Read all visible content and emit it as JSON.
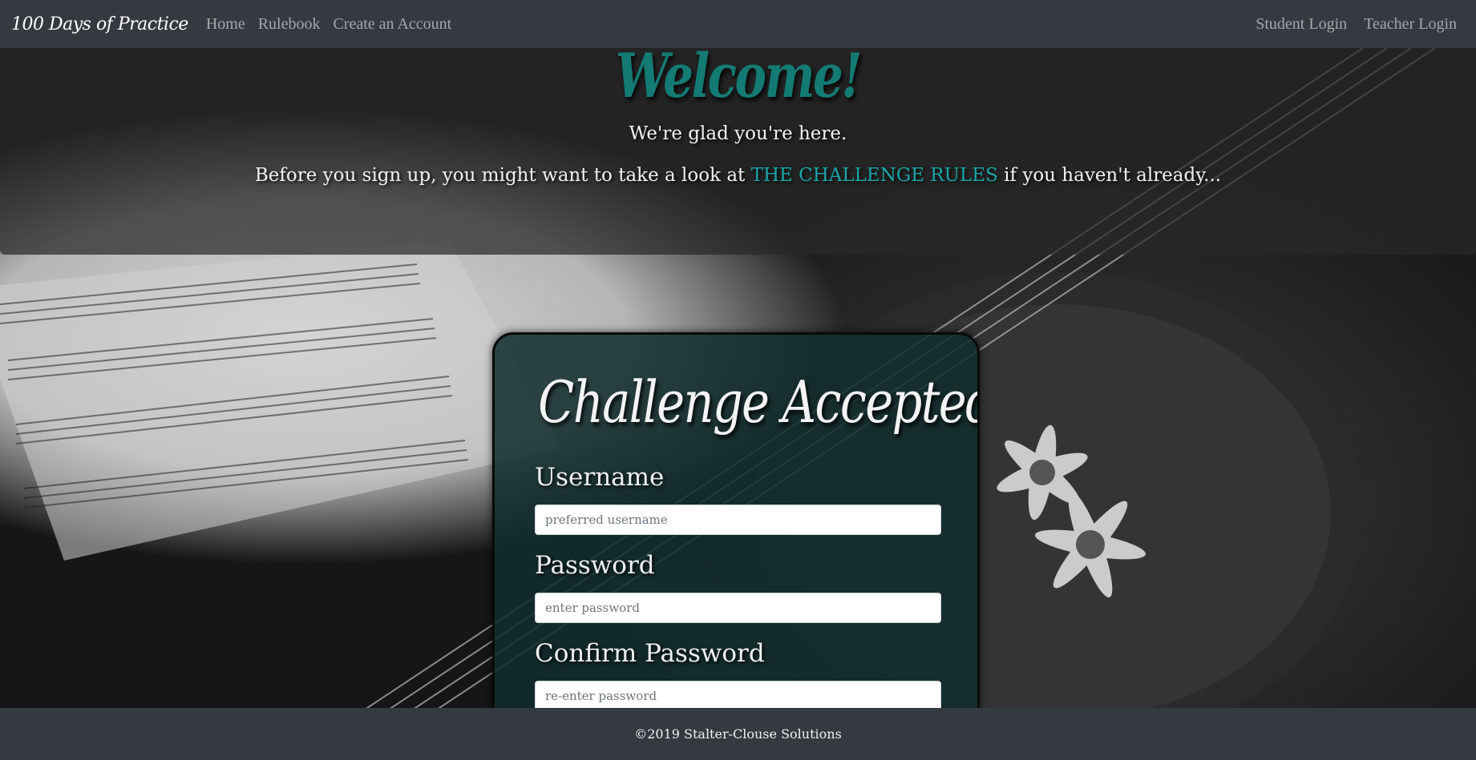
{
  "nav": {
    "brand": "100 Days of Practice",
    "links": [
      "Home",
      "Rulebook",
      "Create an Account"
    ],
    "right_links": [
      "Student Login",
      "Teacher Login"
    ]
  },
  "welcome": {
    "heading": "Welcome!",
    "subtitle": "We're glad you're here.",
    "line_before": "Before you sign up, you might want to take a look at ",
    "rules_link": "THE CHALLENGE RULES",
    "line_after": " if you haven't already..."
  },
  "signup": {
    "title": "Challenge Accepted!",
    "fields": [
      {
        "label": "Username",
        "placeholder": "preferred username",
        "value": ""
      },
      {
        "label": "Password",
        "placeholder": "enter password",
        "value": ""
      },
      {
        "label": "Confirm Password",
        "placeholder": "re-enter password",
        "value": ""
      }
    ]
  },
  "footer": {
    "text": "©2019 Stalter-Clouse Solutions"
  },
  "colors": {
    "navbar": "#343a40",
    "accent_teal": "#1aa6a8",
    "welcome_teal": "#137b74",
    "card_bg": "#122c2c"
  }
}
